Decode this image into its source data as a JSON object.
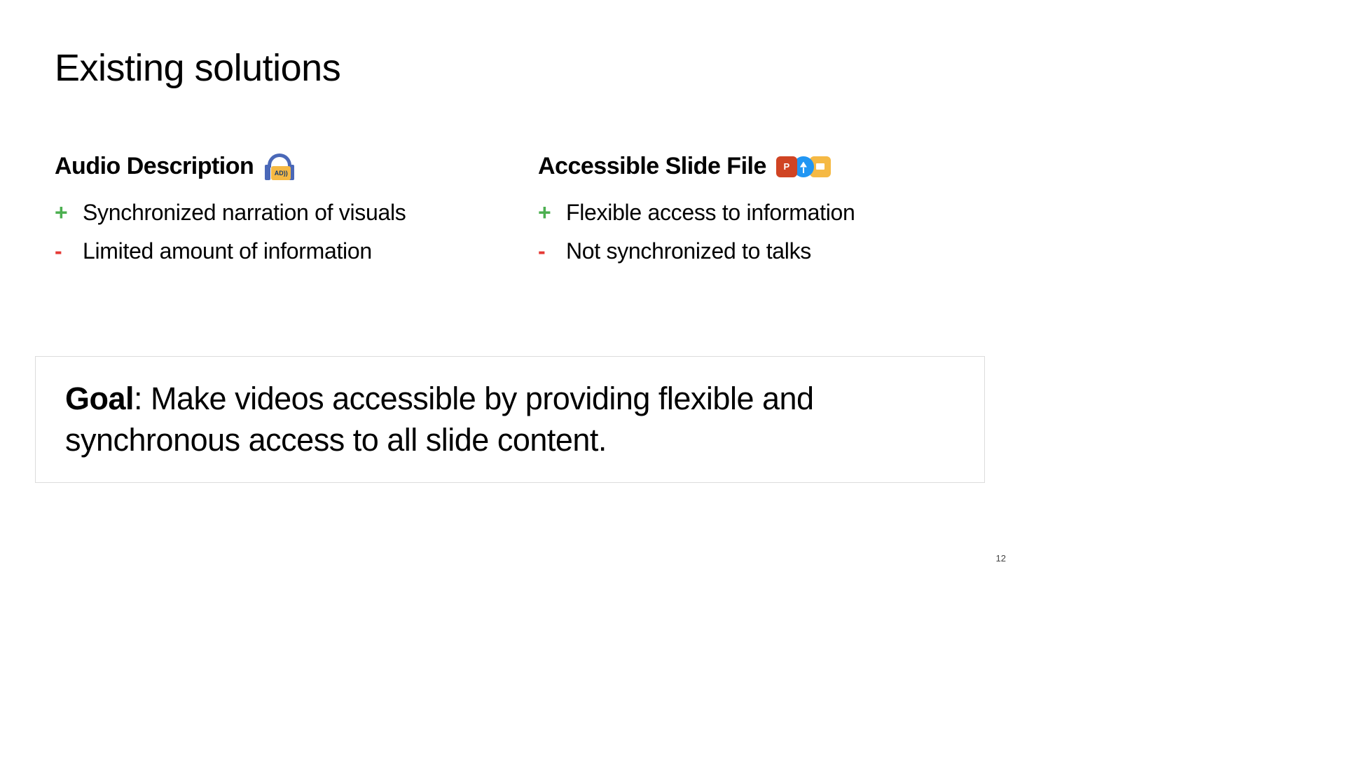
{
  "title": "Existing solutions",
  "columns": [
    {
      "title": "Audio Description",
      "icon_name": "audio-description-icon",
      "icon_label": "AD))",
      "points": [
        {
          "sign": "+",
          "text": "Synchronized narration of visuals"
        },
        {
          "sign": "-",
          "text": "Limited amount of information"
        }
      ]
    },
    {
      "title": "Accessible Slide File",
      "icon_name": "slide-apps-icons",
      "points": [
        {
          "sign": "+",
          "text": "Flexible access to information"
        },
        {
          "sign": "-",
          "text": "Not synchronized to talks"
        }
      ]
    }
  ],
  "goal": {
    "label": "Goal",
    "text": ": Make videos accessible by providing flexible and synchronous access to all slide content."
  },
  "page_number": "12",
  "colors": {
    "plus": "#4caf50",
    "minus": "#e53935"
  }
}
